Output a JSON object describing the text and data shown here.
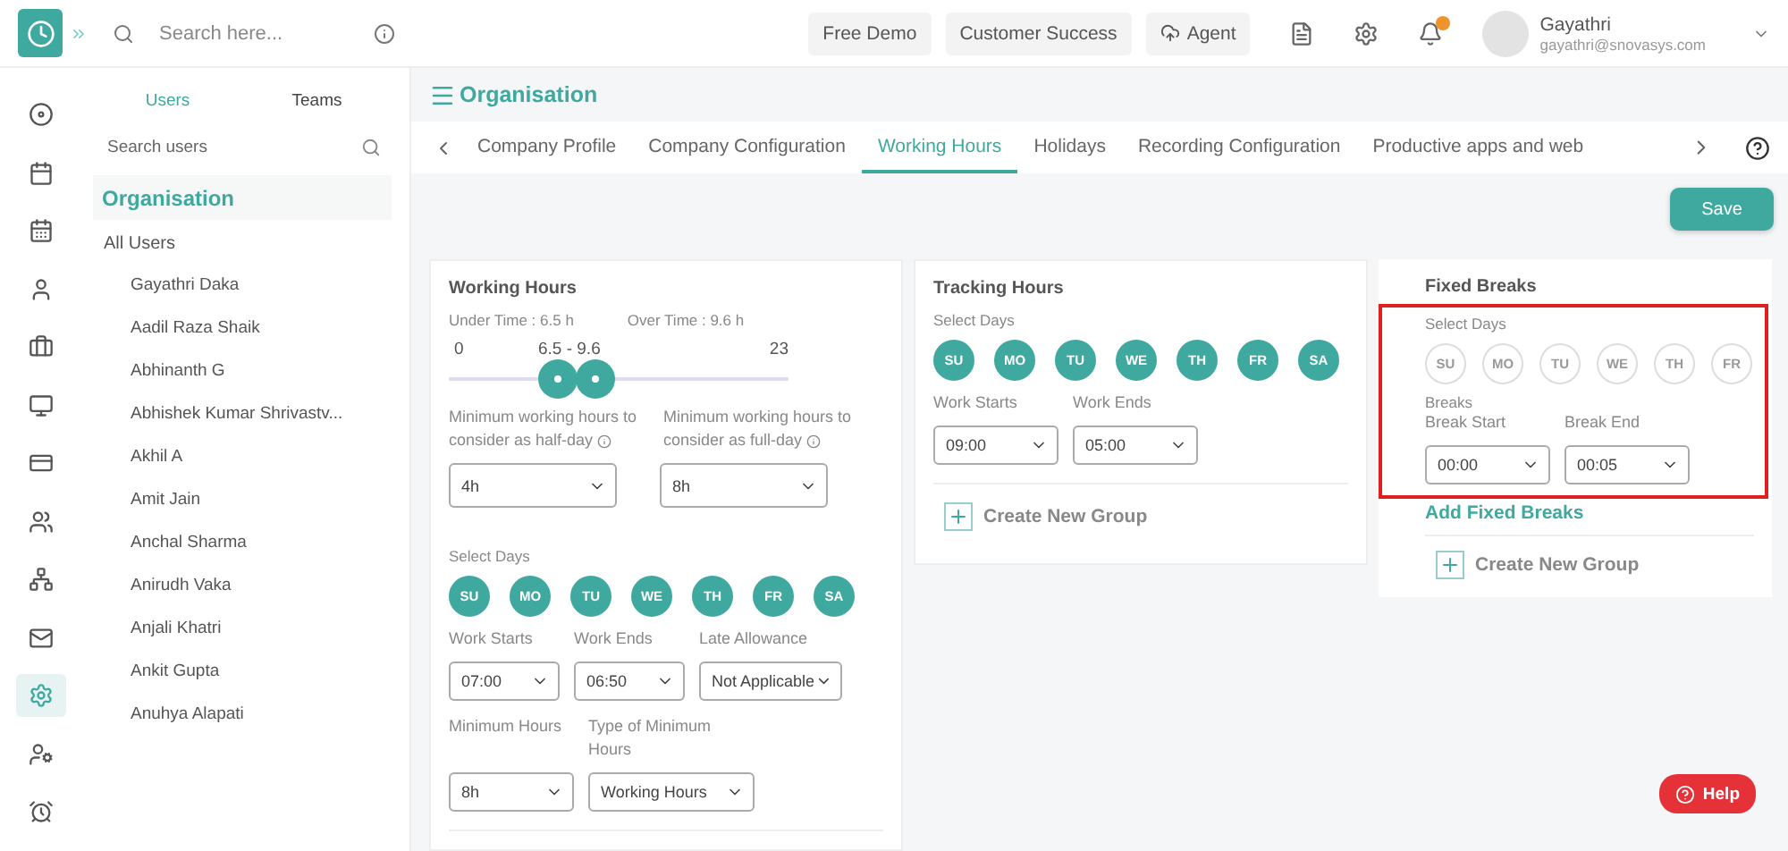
{
  "topbar": {
    "search": {
      "placeholder": "Search here..."
    },
    "buttons": [
      {
        "label": "Free Demo",
        "kind": "plain"
      },
      {
        "label": "Customer Success",
        "kind": "plain"
      },
      {
        "label": "Agent",
        "kind": "cloud"
      }
    ],
    "user": {
      "name": "Gayathri",
      "email": "gayathri@snovasys.com"
    }
  },
  "nav_rail": [
    {
      "selected": false
    },
    {
      "selected": false
    },
    {
      "selected": false
    },
    {
      "selected": false
    },
    {
      "selected": false
    },
    {
      "selected": false
    },
    {
      "selected": false
    },
    {
      "selected": false
    },
    {
      "selected": false
    },
    {
      "selected": false
    },
    {
      "selected": true
    },
    {
      "selected": false
    },
    {
      "selected": false
    }
  ],
  "sidebar": {
    "tabs": [
      {
        "label": "Users",
        "selected": true
      },
      {
        "label": "Teams",
        "selected": false
      }
    ],
    "search": {
      "placeholder": "Search users"
    },
    "heading": "Organisation",
    "group": "All Users",
    "users": [
      "Gayathri Daka",
      "Aadil Raza Shaik",
      "Abhinanth G",
      "Abhishek Kumar Shrivastv...",
      "Akhil A",
      "Amit Jain",
      "Anchal Sharma",
      "Anirudh Vaka",
      "Anjali Khatri",
      "Ankit Gupta",
      "Anuhya Alapati"
    ]
  },
  "page": {
    "title": "Organisation",
    "tabs": [
      {
        "label": "Company Profile",
        "selected": false
      },
      {
        "label": "Company Configuration",
        "selected": false
      },
      {
        "label": "Working Hours",
        "selected": true
      },
      {
        "label": "Holidays",
        "selected": false
      },
      {
        "label": "Recording Configuration",
        "selected": false
      },
      {
        "label": "Productive apps and web",
        "selected": false
      }
    ],
    "save": "Save"
  },
  "working_hours": {
    "title": "Working Hours",
    "under_time": "Under Time : 6.5 h",
    "over_time": "Over Time : 9.6 h",
    "slider": {
      "min": "0",
      "range": "6.5 - 9.6",
      "max": "23",
      "thumbs": [
        {
          "level": 0.32
        },
        {
          "level": 0.43
        }
      ]
    },
    "limits": [
      {
        "label": "Minimum working hours to consider as half-day",
        "value": "4h"
      },
      {
        "label": "Minimum working hours to consider as full-day",
        "value": "8h"
      }
    ],
    "days_label": "Select Days",
    "days": [
      {
        "label": "SU",
        "selected": true
      },
      {
        "label": "MO",
        "selected": true
      },
      {
        "label": "TU",
        "selected": true
      },
      {
        "label": "WE",
        "selected": true
      },
      {
        "label": "TH",
        "selected": true
      },
      {
        "label": "FR",
        "selected": true
      },
      {
        "label": "SA",
        "selected": true
      }
    ],
    "fields": [
      {
        "label": "Work Starts",
        "value": "07:00"
      },
      {
        "label": "Work Ends",
        "value": "06:50"
      },
      {
        "label": "Late Allowance",
        "value": "Not Applicable"
      }
    ],
    "min_fields": [
      {
        "label": "Minimum Hours",
        "value": "8h"
      },
      {
        "label": "Type of Minimum Hours",
        "value": "Working Hours"
      }
    ]
  },
  "tracking_hours": {
    "title": "Tracking Hours",
    "days_label": "Select Days",
    "days": [
      {
        "label": "SU",
        "selected": true
      },
      {
        "label": "MO",
        "selected": true
      },
      {
        "label": "TU",
        "selected": true
      },
      {
        "label": "WE",
        "selected": true
      },
      {
        "label": "TH",
        "selected": true
      },
      {
        "label": "FR",
        "selected": true
      },
      {
        "label": "SA",
        "selected": true
      }
    ],
    "fields": [
      {
        "label": "Work Starts",
        "value": "09:00"
      },
      {
        "label": "Work Ends",
        "value": "05:00"
      }
    ],
    "create_group": "Create New Group"
  },
  "fixed_breaks": {
    "title": "Fixed Breaks",
    "days_label": "Select Days",
    "days": [
      {
        "label": "SU",
        "selected": false
      },
      {
        "label": "MO",
        "selected": false
      },
      {
        "label": "TU",
        "selected": false
      },
      {
        "label": "WE",
        "selected": false
      },
      {
        "label": "TH",
        "selected": false
      },
      {
        "label": "FR",
        "selected": false
      }
    ],
    "breaks_label": "Breaks",
    "fields": [
      {
        "label": "Break Start",
        "value": "00:00"
      },
      {
        "label": "Break End",
        "value": "00:05"
      }
    ],
    "add_link": "Add Fixed Breaks",
    "create_group": "Create New Group"
  },
  "help": "Help"
}
